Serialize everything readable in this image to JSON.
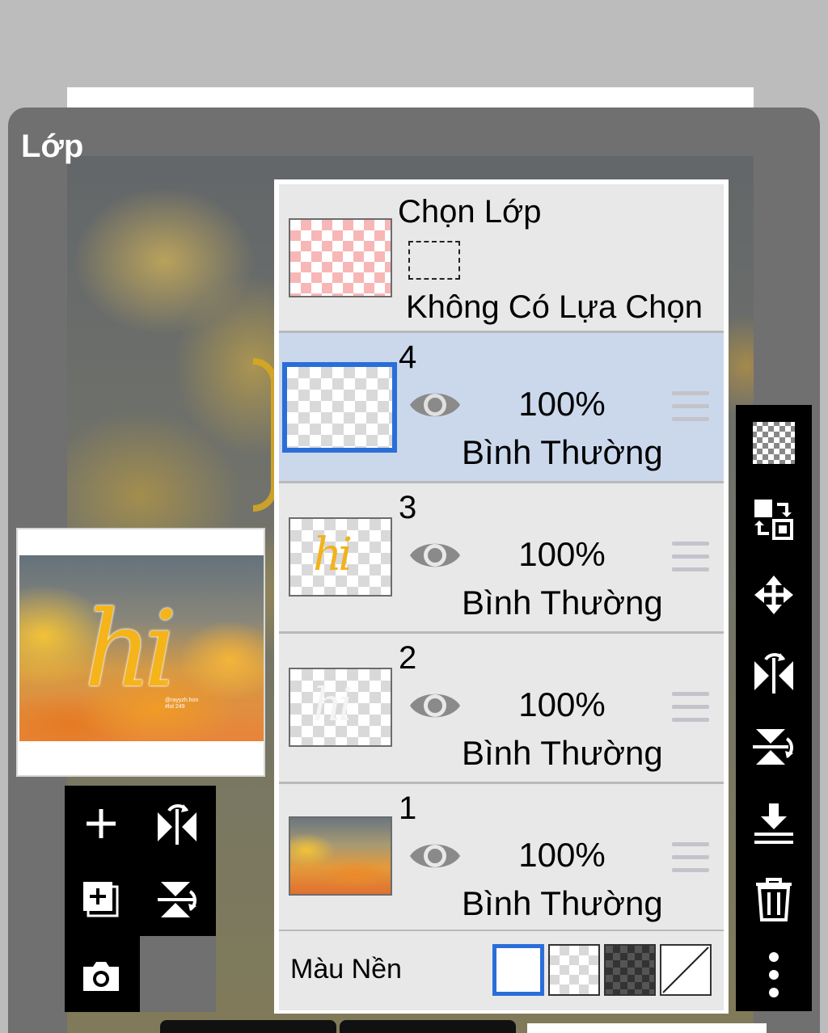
{
  "panel": {
    "title": "Lớp"
  },
  "selection": {
    "title": "Chọn Lớp",
    "status": "Không Có Lựa Chọn"
  },
  "layers": [
    {
      "number": "4",
      "opacity": "100%",
      "blend": "Bình Thường",
      "selected": true,
      "thumbnail": "empty-checker"
    },
    {
      "number": "3",
      "opacity": "100%",
      "blend": "Bình Thường",
      "selected": false,
      "thumbnail": "hi-lettering-gold"
    },
    {
      "number": "2",
      "opacity": "100%",
      "blend": "Bình Thường",
      "selected": false,
      "thumbnail": "hi-lettering-white"
    },
    {
      "number": "1",
      "opacity": "100%",
      "blend": "Bình Thường",
      "selected": false,
      "thumbnail": "cloud-photo"
    }
  ],
  "background": {
    "label": "Màu Nền",
    "swatches": [
      "white",
      "checker",
      "dark-checker",
      "none"
    ],
    "selected": "white"
  },
  "preview": {
    "lettering": "hi",
    "signature_line1": "@rayyzh.hon",
    "signature_line2": "#lol 249"
  },
  "left_tools": [
    "add-layer-icon",
    "flip-horizontal-icon",
    "add-copy-layer-icon",
    "flip-vertical-icon",
    "camera-icon"
  ],
  "right_tools": [
    "transparency-checker-icon",
    "swap-layers-icon",
    "move-icon",
    "flip-horizontal-icon",
    "flip-vertical-icon",
    "merge-down-icon",
    "trash-icon",
    "more-icon"
  ],
  "colors": {
    "accent": "#2a6ed9",
    "selected_row": "#cbd8ec",
    "row_bg": "#e8e8e8",
    "panel_bg": "#707070"
  }
}
